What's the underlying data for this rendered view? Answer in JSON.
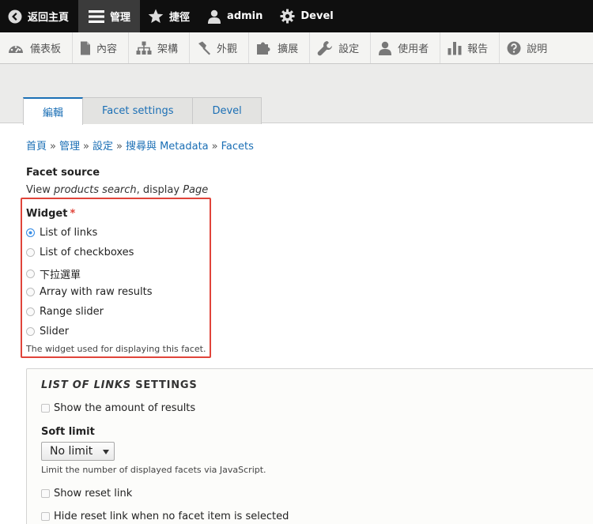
{
  "toolbar": {
    "back": "返回主頁",
    "manage": "管理",
    "shortcuts": "捷徑",
    "user": "admin",
    "devel": "Devel"
  },
  "tray": {
    "items": [
      "儀表板",
      "內容",
      "架構",
      "外觀",
      "擴展",
      "設定",
      "使用者",
      "報告",
      "說明"
    ]
  },
  "tabs": [
    "編輯",
    "Facet settings",
    "Devel"
  ],
  "breadcrumb": [
    "首頁",
    "管理",
    "設定",
    "搜尋與 Metadata",
    "Facets"
  ],
  "breadcrumb_sep": "»",
  "facet_source": {
    "label": "Facet source",
    "prefix": "View ",
    "view": "products search",
    "middle": ", display ",
    "display": "Page"
  },
  "widget": {
    "label": "Widget",
    "required_mark": "*",
    "options": [
      "List of links",
      "List of checkboxes",
      "下拉選單",
      "Array with raw results",
      "Range slider",
      "Slider"
    ],
    "selected_index": 0,
    "description": "The widget used for displaying this facet."
  },
  "settings": {
    "title_em": "LIST OF LINKS",
    "title_rest": " SETTINGS",
    "show_amount": "Show the amount of results",
    "soft_limit_label": "Soft limit",
    "soft_limit_value": "No limit",
    "soft_limit_desc": "Limit the number of displayed facets via JavaScript.",
    "show_reset": "Show reset link",
    "hide_reset": "Hide reset link when no facet item is selected"
  },
  "colors": {
    "link": "#1b6fb5",
    "highlight_border": "#e0443a",
    "toolbar_bg": "#0f0f0f"
  }
}
